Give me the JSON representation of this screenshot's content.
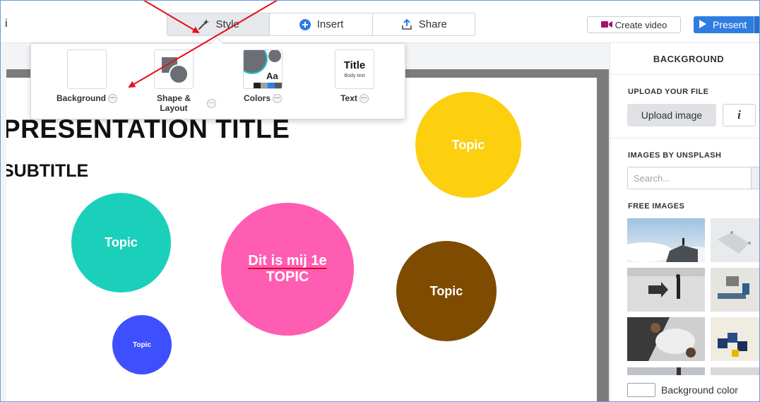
{
  "app": {
    "title": "i"
  },
  "tabs": [
    {
      "label": "Style",
      "icon": "magic-wand-icon",
      "active": true
    },
    {
      "label": "Insert",
      "icon": "plus-circle-icon",
      "active": false
    },
    {
      "label": "Share",
      "icon": "share-upload-icon",
      "active": false
    }
  ],
  "header": {
    "create_video_label": "Create video",
    "create_video_icon": "video-camera-icon",
    "present_label": "Present",
    "present_icon": "play-icon"
  },
  "style_panel": {
    "options": [
      {
        "label": "Background",
        "has_more": true
      },
      {
        "label": "Shape & Layout",
        "has_more": true
      },
      {
        "label": "Colors",
        "has_more": true
      },
      {
        "label": "Text",
        "has_more": true
      }
    ],
    "colors_thumb_text": "Aa",
    "text_thumb_title": "Title",
    "text_thumb_body": "Body text",
    "more_glyph": "···"
  },
  "slide": {
    "title": "PRESENTATION TITLE",
    "subtitle": "SUBTITLE",
    "topics": [
      {
        "id": "yellow",
        "lines": [
          "Topic"
        ],
        "color": "#fccf0f"
      },
      {
        "id": "teal",
        "lines": [
          "Topic"
        ],
        "color": "#1bd0bb"
      },
      {
        "id": "pink",
        "lines": [
          "Dit is mij 1e",
          "TOPIC"
        ],
        "color": "#ff5db1"
      },
      {
        "id": "brown",
        "lines": [
          "Topic"
        ],
        "color": "#7e4b00"
      },
      {
        "id": "blue",
        "lines": [
          "Topic"
        ],
        "color": "#3e4ffe"
      }
    ]
  },
  "sidebar": {
    "header": "BACKGROUND",
    "upload_heading": "UPLOAD YOUR FILE",
    "upload_button": "Upload image",
    "info_button": "i",
    "unsplash_heading": "IMAGES BY UNSPLASH",
    "search_placeholder": "Search...",
    "free_images_heading": "FREE IMAGES",
    "background_color_label": "Background color"
  },
  "colors": {
    "accent_blue": "#2f7de1",
    "annotation_red": "#e8101c",
    "video_icon": "#a4126a"
  }
}
